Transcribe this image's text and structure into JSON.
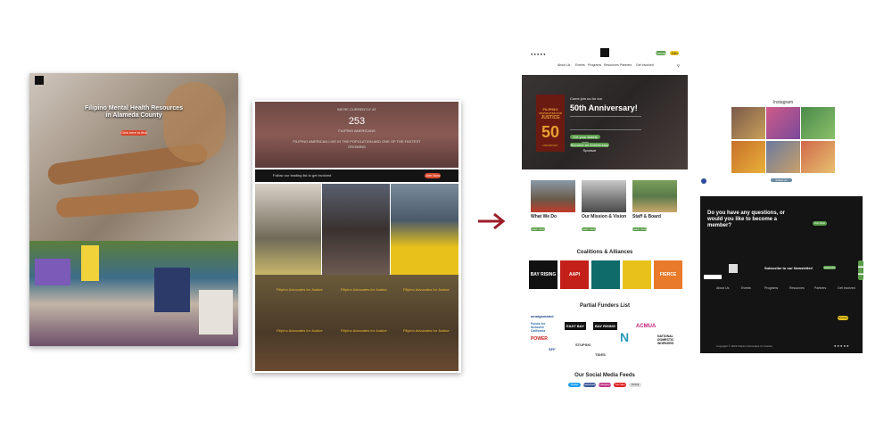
{
  "left_mock": {
    "hero_title": "Filipino Mental Health Resources in Alameda County",
    "hero_button": "Click here to find"
  },
  "middle_mock": {
    "banner_line1": "WE'RE CURRENTLY AT",
    "stat_number": "253",
    "stat_label": "FILIPINO AMERICANS",
    "banner_line2": "FILIPINO AMERICAN LIVE IN THE POPULATION AND ONE OF THE FASTEST GROWING",
    "follow_text": "Follow our leading list to get involved",
    "follow_button": "Join Now",
    "card_titles": [
      "Filipino Advocates for Justice",
      "Filipino Advocates for Justice",
      "Filipino Advocates for Justice",
      "Filipino Advocates for Justice",
      "Filipino Advocates for Justice",
      "Filipino Advocates for Justice"
    ]
  },
  "site": {
    "header_buttons": {
      "donate": "Donate",
      "join": "Join"
    },
    "nav": [
      "About Us",
      "Events",
      "Programs",
      "Resources",
      "Partners",
      "Get Involved"
    ],
    "hero_kicker": "Come join us for our",
    "hero_title": "50th Anniversary!",
    "hero_button_1": "Get your tickets now",
    "hero_button_2": "Become an Anniversary Sponsor",
    "poster": {
      "line1": "FILIPINO",
      "line2": "ADVOCATES FOR",
      "line3": "JUSTICE",
      "number": "50",
      "sub": "ANNIVERSARY"
    },
    "columns": [
      {
        "title": "What We Do",
        "button": "Learn more"
      },
      {
        "title": "Our Mission & Vision",
        "button": "Learn more"
      },
      {
        "title": "Staff & Board",
        "button": "Learn more"
      }
    ],
    "coalitions_title": "Coalitions & Alliances",
    "coalition_logos": [
      "BAY RISING",
      "AAPI",
      "",
      "",
      "FIERCE"
    ],
    "funders_title": "Partial Funders List",
    "funders": [
      "amalgamated",
      "Funds for Inclusive California",
      "EAST BAY",
      "BAY RISING",
      "TIDES",
      "ACMUA",
      "STUPSKI",
      "N",
      "NATIONAL DOMESTIC WORKERS",
      "POWER",
      "SFF"
    ],
    "social_title": "Our Social Media Feeds",
    "social_buttons": [
      "Twitter",
      "Facebook",
      "Instagram",
      "YouTube",
      "TikTok"
    ]
  },
  "instagram": {
    "title": "Instagram",
    "button": "Follow on Instagram"
  },
  "footer": {
    "question": "Do you have any questions, or would you like to become a member?",
    "join_button": "Join Now",
    "newsletter": "Subscribe to our Newsletter!",
    "newsletter_button": "Subscribe",
    "columns": [
      "About Us",
      "Events",
      "Programs",
      "Resources",
      "Partners",
      "Get Involved"
    ],
    "donate_button": "Donate",
    "copyright": "Copyright © 2023 Filipino Advocates for Justice"
  },
  "colors": {
    "arrow": "#9c1c2a",
    "green": "#5a9e4a",
    "yellow": "#e8c21a",
    "dark": "#141414"
  }
}
